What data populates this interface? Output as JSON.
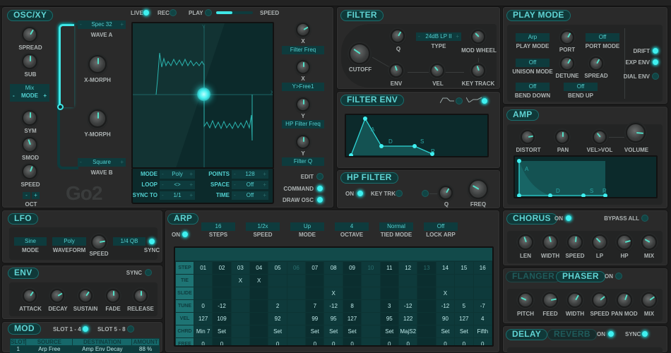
{
  "osc": {
    "title": "OSC/XY",
    "live": "LIVE",
    "rec": "REC",
    "play": "PLAY",
    "speed": "SPEED",
    "play_speed_fraction": 0.45,
    "spread": "SPREAD",
    "sub": "SUB",
    "sym": "SYM",
    "smod": "SMOD",
    "speed_knob": "SPEED",
    "mode_value": "Mix",
    "mode_label": "MODE",
    "mode_minus": "-",
    "mode_plus": "+",
    "oct_label": "OCT",
    "oct_minus": "-",
    "oct_plus": "+",
    "wave_a_value": "Spec 32",
    "wave_a_label": "WAVE A",
    "wave_b_value": "Square",
    "wave_b_label": "WAVE B",
    "x_morph": "X-MORPH",
    "y_morph": "Y-MORPH",
    "logo": "Go2",
    "xy_axis_x": "X",
    "xy_axis_y": "Y",
    "xy": {
      "mode_label": "MODE",
      "mode_value": "Poly",
      "loop_label": "LOOP",
      "loop_value": "<>",
      "syncto_label": "SYNC TO",
      "syncto_value": "1/1",
      "points_label": "POINTS",
      "points_value": "128",
      "space_label": "SPACE",
      "space_value": "Off",
      "time_label": "TIME",
      "time_value": "Off"
    },
    "assign": [
      {
        "axis": "X",
        "target": "Filter Freq"
      },
      {
        "axis": "X",
        "target": "Y>Free1"
      },
      {
        "axis": "Y",
        "target": "HP Filter Freq"
      },
      {
        "axis": "Y",
        "target": "Filter Q"
      }
    ],
    "edit": "EDIT",
    "command": "COMMAND",
    "draw_osc": "DRAW OSC"
  },
  "filter": {
    "title": "FILTER",
    "cutoff": "CUTOFF",
    "q": "Q",
    "type_value": "24dB LP II",
    "type_label": "TYPE",
    "mod_wheel": "MOD WHEEL",
    "env": "ENV",
    "vel": "VEL",
    "key_track": "KEY TRACK"
  },
  "filter_env": {
    "title": "FILTER ENV",
    "points": [
      "A",
      "D",
      "S",
      "R"
    ]
  },
  "hp_filter": {
    "title": "HP FILTER",
    "on": "ON",
    "key_trk": "KEY TRK",
    "q": "Q",
    "freq": "FREQ"
  },
  "play_mode": {
    "title": "PLAY MODE",
    "play_mode_value": "Arp",
    "play_mode_label": "PLAY MODE",
    "port": "PORT",
    "port_mode_value": "Off",
    "port_mode_label": "PORT MODE",
    "unison_value": "Off",
    "unison_label": "UNISON MODE",
    "detune": "DETUNE",
    "spread": "SPREAD",
    "bend_down_value": "Off",
    "bend_down_label": "BEND DOWN",
    "bend_up_value": "Off",
    "bend_up_label": "BEND UP",
    "drift": "DRIFT",
    "exp_env": "EXP ENV",
    "dial_env": "DIAL ENV"
  },
  "amp": {
    "title": "AMP",
    "distort": "DISTORT",
    "pan": "PAN",
    "vel_vol": "VEL>VOL",
    "volume": "VOLUME",
    "points": [
      "A",
      "D",
      "S",
      "R"
    ]
  },
  "lfo": {
    "title": "LFO",
    "mode_value": "Sine",
    "mode_label": "MODE",
    "waveform_value": "Poly",
    "waveform_label": "WAVEFORM",
    "speed": "SPEED",
    "sync_value": "1/4 QB",
    "sync": "SYNC"
  },
  "env": {
    "title": "ENV",
    "sync": "SYNC",
    "attack": "ATTACK",
    "decay": "DECAY",
    "sustain": "SUSTAIN",
    "fade": "FADE",
    "release": "RELEASE"
  },
  "mod": {
    "title": "MOD",
    "slot14": "SLOT 1 - 4",
    "slot58": "SLOT 5 - 8",
    "headers": [
      "SLOT",
      "SOURCE",
      "DESTINATION",
      "AMOUNT"
    ],
    "rows": [
      [
        "1",
        "Arp Free",
        "Amp Env Decay",
        "88 %"
      ]
    ]
  },
  "arp": {
    "title": "ARP",
    "on": "ON",
    "params": [
      {
        "value": "16",
        "label": "STEPS"
      },
      {
        "value": "1/2x",
        "label": "SPEED"
      },
      {
        "value": "Up",
        "label": "MODE"
      },
      {
        "value": "4",
        "label": "OCTAVE"
      },
      {
        "value": "Normal",
        "label": "TIED MODE"
      },
      {
        "value": "Off",
        "label": "LOCK ARP"
      }
    ],
    "row_labels": [
      "STEP",
      "TIE",
      "SLIDE",
      "TUNE",
      "VEL",
      "CHRD",
      "FREE"
    ],
    "steps": [
      "01",
      "02",
      "03",
      "04",
      "05",
      "06",
      "07",
      "08",
      "09",
      "10",
      "11",
      "12",
      "13",
      "14",
      "15",
      "16"
    ],
    "tie": [
      "",
      "",
      "X",
      "X",
      "",
      "",
      "",
      "",
      "",
      "",
      "",
      "",
      "",
      "",
      "",
      ""
    ],
    "slide": [
      "",
      "",
      "",
      "",
      "",
      "",
      "",
      "X",
      "",
      "",
      "",
      "",
      "",
      "X",
      "",
      ""
    ],
    "tune": [
      "0",
      "-12",
      "",
      "",
      "2",
      "",
      "7",
      "-12",
      "8",
      "",
      "3",
      "-12",
      "",
      "-12",
      "5",
      "-7"
    ],
    "vel": [
      "127",
      "109",
      "",
      "",
      "92",
      "",
      "99",
      "95",
      "127",
      "",
      "95",
      "122",
      "",
      "90",
      "127",
      "4"
    ],
    "chrd": [
      "Min 7",
      "Set",
      "",
      "",
      "Set",
      "",
      "Set",
      "Set",
      "Set",
      "",
      "Set",
      "MajS2",
      "",
      "Set",
      "Set",
      "Fifth"
    ],
    "free": [
      "0",
      "0",
      "",
      "",
      "0",
      "",
      "0",
      "0",
      "0",
      "",
      "0",
      "0",
      "",
      "0",
      "0",
      "0"
    ]
  },
  "chorus": {
    "title": "CHORUS",
    "on": "ON",
    "bypass_all": "BYPASS ALL",
    "knobs": [
      "LEN",
      "WIDTH",
      "SPEED",
      "LP",
      "HP",
      "MIX"
    ]
  },
  "phaser": {
    "flanger": "FLANGER",
    "title": "PHASER",
    "on": "ON",
    "knobs": [
      "PITCH",
      "FEED",
      "WIDTH",
      "SPEED",
      "PAN MOD",
      "MIX"
    ]
  },
  "delay": {
    "title": "DELAY",
    "reverb": "REVERB",
    "on": "ON",
    "sync": "SYNC"
  }
}
